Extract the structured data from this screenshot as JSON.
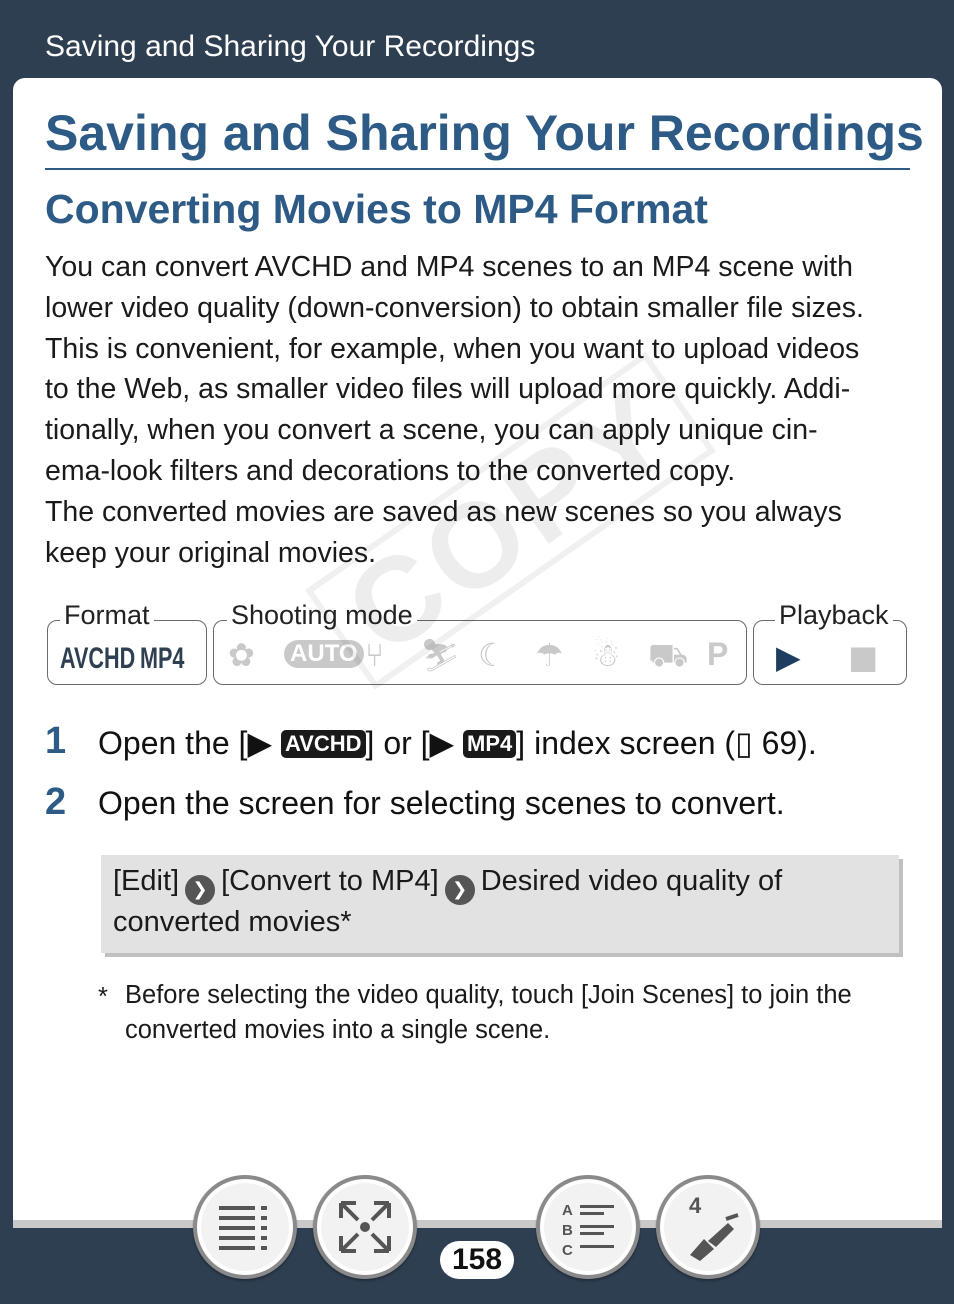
{
  "header": {
    "section_title": "Saving and Sharing Your Recordings"
  },
  "page_title": "Saving and Sharing Your Recordings",
  "section_heading": "Converting Movies to MP4 Format",
  "intro_lines": [
    "You can convert AVCHD and MP4 scenes to an MP4 scene with",
    "lower video quality (down-conversion) to obtain smaller file sizes.",
    "This is convenient, for example, when you want to upload videos",
    "to the Web, as smaller video files will upload more quickly. Addi-",
    "tionally, when you convert a scene, you can apply unique cin-",
    "ema-look filters and decorations to the converted copy.",
    "The converted movies are saved as new scenes so you always",
    "keep your original movies."
  ],
  "watermark": "COPY",
  "availability": {
    "format_label": "Format",
    "formats": [
      "AVCHD",
      "MP4"
    ],
    "shooting_mode_label": "Shooting mode",
    "shooting_mode_icons": [
      "portrait-icon",
      "auto-icon",
      "food-icon",
      "sports-icon",
      "night-icon",
      "beach-icon",
      "snow-icon",
      "car-icon",
      "program-icon"
    ],
    "mode_auto_text": "AUTO",
    "mode_p_text": "P",
    "playback_label": "Playback",
    "playback_icons": [
      "movie-playback-icon",
      "photo-playback-icon"
    ]
  },
  "steps": [
    {
      "number": "1",
      "text_a": "Open the [",
      "tag_a": "AVCHD",
      "text_b": "] or [",
      "tag_b": "MP4",
      "text_c": "] index screen (",
      "page_ref": "69",
      "text_d": ")."
    },
    {
      "number": "2",
      "text": "Open the screen for selecting scenes to convert."
    }
  ],
  "procedure": {
    "item1": "[Edit]",
    "item2": "[Convert to MP4]",
    "item3": "Desired video quality of",
    "item3_cont": "converted movies*"
  },
  "footnote": {
    "marker": "*",
    "line1": "Before selecting the video quality, touch [Join Scenes] to join the",
    "line2": "converted movies into a single scene."
  },
  "nav": {
    "buttons": [
      "contents-icon",
      "fullscreen-icon",
      "index-icon",
      "reference-icon"
    ],
    "abc_a": "A",
    "abc_b": "B",
    "abc_c": "C",
    "ref_num": "4",
    "page_number": "158"
  },
  "colors": {
    "accent": "#2d5b86",
    "frame": "#2e3f52"
  }
}
